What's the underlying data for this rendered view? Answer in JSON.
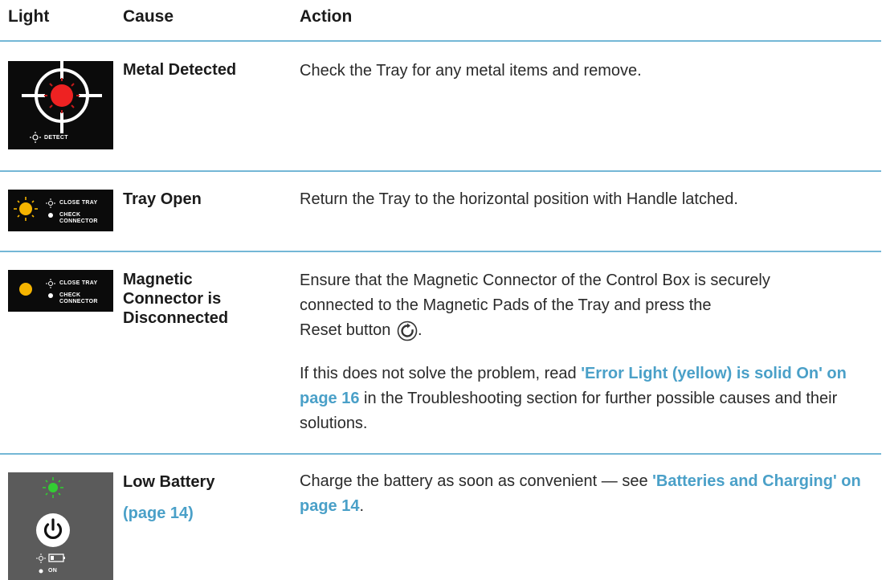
{
  "headers": {
    "light": "Light",
    "cause": "Cause",
    "action": "Action"
  },
  "rows": [
    {
      "cause": "Metal Detected",
      "action": "Check the Tray for any metal items and remove.",
      "indicator_label": "DETECT",
      "indicator_color": "#ee2222"
    },
    {
      "cause": "Tray Open",
      "action": "Return the Tray to the horizontal position with Handle latched.",
      "indicator_label_1": "CLOSE TRAY",
      "indicator_label_2": "CHECK",
      "indicator_label_3": "CONNECTOR",
      "indicator_color": "#f5b400"
    },
    {
      "cause_line_1": "Magnetic",
      "cause_line_2": "Connector is",
      "cause_line_3": "Disconnected",
      "action_line_1": "Ensure that the Magnetic Connector of the Control Box is securely",
      "action_line_2": "connected to the Magnetic Pads of the Tray and press the",
      "action_line_3": "Reset button",
      "action_line_3_end": ".",
      "follow_up_prefix": "If this does not solve the problem, read ",
      "follow_up_link": "'Error Light (yellow) is solid On' on page 16",
      "follow_up_suffix": " in the Troubleshooting section for further possible causes and their solutions.",
      "indicator_label_1": "CLOSE TRAY",
      "indicator_label_2": "CHECK",
      "indicator_label_3": "CONNECTOR",
      "indicator_color": "#f5b400"
    },
    {
      "cause": "Low Battery",
      "cause_link": "(page 14)",
      "action_prefix": "Charge the battery as soon as convenient  — see ",
      "action_link": "'Batteries and Charging' on page 14",
      "action_suffix": ".",
      "indicator_label": "ON",
      "indicator_color": "#33cc33"
    }
  ],
  "colors": {
    "rule": "#74b7d6",
    "link": "#4aa0c8"
  }
}
